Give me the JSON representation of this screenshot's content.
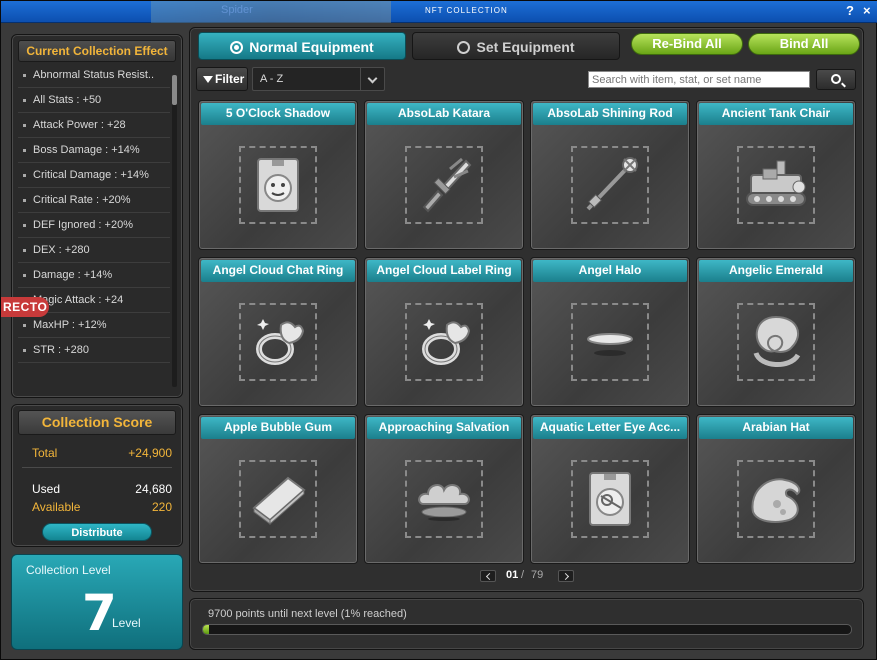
{
  "window": {
    "title": "NFT COLLECTION",
    "background_title": "Spider",
    "help": "?",
    "close": "×"
  },
  "effect": {
    "title": "Current Collection Effect",
    "items": [
      "Abnormal Status Resist..",
      "All Stats : +50",
      "Attack Power : +28",
      "Boss Damage : +14%",
      "Critical Damage : +14%",
      "Critical Rate : +20%",
      "DEF Ignored : +20%",
      "DEX : +280",
      "Damage : +14%",
      "Magic Attack : +24",
      "MaxHP : +12%",
      "STR : +280"
    ],
    "overlay_tag": "RECTO"
  },
  "score": {
    "title": "Collection Score",
    "total_label": "Total",
    "total_value": "+24,900",
    "used_label": "Used",
    "used_value": "24,680",
    "available_label": "Available",
    "available_value": "220",
    "distribute": "Distribute",
    "colors": {
      "gold": "#f2b53a",
      "white": "#ffffff"
    }
  },
  "level": {
    "label": "Collection Level",
    "value": "7",
    "unit": "Level"
  },
  "tabs": {
    "normal": "Normal Equipment",
    "set": "Set Equipment"
  },
  "actions": {
    "rebind_all": "Re-Bind All",
    "bind_all": "Bind All"
  },
  "toolbar": {
    "filter": "Filter",
    "sort": "A - Z",
    "search_placeholder": "Search with item, stat, or set name"
  },
  "items": [
    {
      "name": "5 O'Clock Shadow",
      "icon": "face-card-icon"
    },
    {
      "name": "AbsoLab Katara",
      "icon": "dagger-icon"
    },
    {
      "name": "AbsoLab Shining Rod",
      "icon": "rod-icon"
    },
    {
      "name": "Ancient Tank Chair",
      "icon": "tank-icon"
    },
    {
      "name": "Angel Cloud Chat Ring",
      "icon": "ring-icon"
    },
    {
      "name": "Angel Cloud Label Ring",
      "icon": "ring-icon"
    },
    {
      "name": "Angel Halo",
      "icon": "halo-icon"
    },
    {
      "name": "Angelic Emerald",
      "icon": "emerald-icon"
    },
    {
      "name": "Apple Bubble Gum",
      "icon": "gum-icon"
    },
    {
      "name": "Approaching Salvation",
      "icon": "cloud-icon"
    },
    {
      "name": "Aquatic Letter Eye Acc...",
      "icon": "eye-card-icon"
    },
    {
      "name": "Arabian Hat",
      "icon": "hat-icon"
    }
  ],
  "pager": {
    "current": "01",
    "separator": "/",
    "total": "79"
  },
  "progress": {
    "text": "9700 points until next level (1% reached)",
    "percent": 1
  },
  "accent": {
    "teal": "#1b8fa0",
    "green": "#8cc63a"
  }
}
